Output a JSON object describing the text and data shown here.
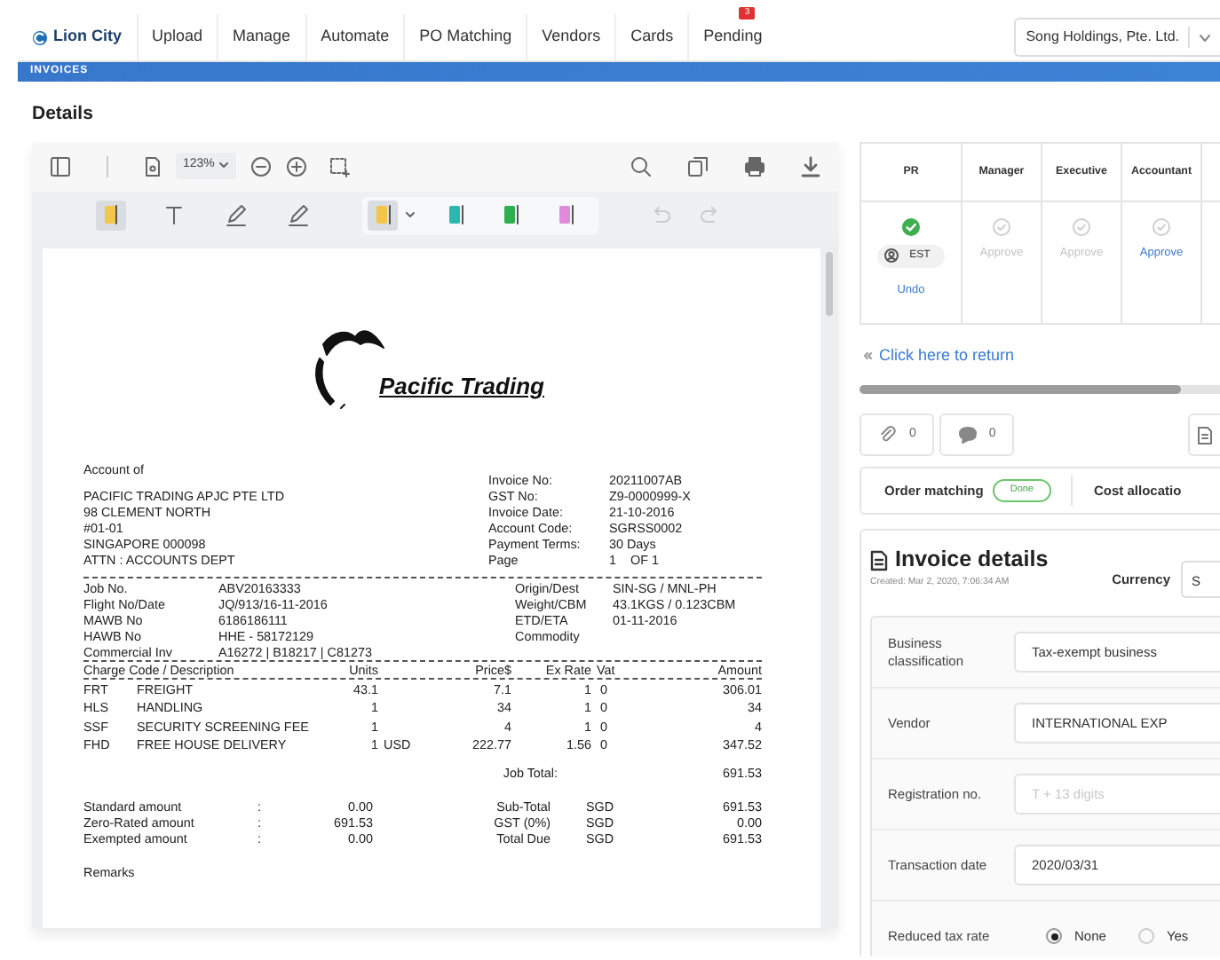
{
  "nav": {
    "logo": "Lion City",
    "tabs": [
      {
        "label": "Upload"
      },
      {
        "label": "Manage"
      },
      {
        "label": "Automate"
      },
      {
        "label": "PO Matching"
      },
      {
        "label": "Vendors"
      },
      {
        "label": "Cards"
      },
      {
        "label": "Pending",
        "badge": "3"
      }
    ],
    "company": "Song Holdings, Pte. Ltd."
  },
  "band": "INVOICES",
  "heading": "Details",
  "viewer": {
    "zoom": "123%",
    "tools": [
      {
        "kind": "highlight",
        "selected": true
      },
      {
        "kind": "text",
        "selected": false
      },
      {
        "kind": "pen",
        "selected": false
      },
      {
        "kind": "pen",
        "selected": false
      }
    ],
    "colors": [
      {
        "color": "#f3c54a",
        "selected": true
      },
      {
        "color": "#2bb8b0",
        "selected": false
      },
      {
        "color": "#2fae4e",
        "selected": false
      },
      {
        "color": "#e18bdc",
        "selected": false
      }
    ],
    "history": [
      {
        "kind": "undo",
        "disabled": true
      },
      {
        "kind": "redo",
        "disabled": true
      }
    ]
  },
  "document": {
    "company": "Pacific Trading",
    "account_title": "Account of",
    "address": [
      "PACIFIC TRADING APJC PTE LTD",
      "98 CLEMENT NORTH",
      "#01-01",
      "SINGAPORE 000098",
      "ATTN : ACCOUNTS DEPT"
    ],
    "invoice_info": [
      [
        "Invoice No:",
        "20211007AB"
      ],
      [
        "GST No:",
        "Z9-0000999-X"
      ],
      [
        "Invoice Date:",
        "21-10-2016"
      ],
      [
        "Account Code:",
        "SGRSS0002"
      ],
      [
        "Payment Terms:",
        "30 Days"
      ],
      [
        "Page",
        "1    OF 1"
      ]
    ],
    "shipment": [
      {
        "label": "Job No.",
        "value": "ABV20163333",
        "label_2": "Origin/Dest",
        "value_2": "SIN-SG / MNL-PH"
      },
      {
        "label": "Flight No/Date",
        "value": "JQ/913/16-11-2016",
        "label_2": "Weight/CBM",
        "value_2": "43.1KGS / 0.123CBM"
      },
      {
        "label": "MAWB No",
        "value": "6186186111",
        "label_2": "ETD/ETA",
        "value_2": "01-11-2016"
      },
      {
        "label": "HAWB No",
        "value": "HHE - 58172129",
        "label_2": "Commodity"
      },
      {
        "label": "Commercial Inv",
        "value": "A16272 | B18217 | C81273"
      }
    ],
    "charge_columns": [
      "Charge Code / Description",
      "Units",
      "Price$",
      "Ex Rate",
      "Vat",
      "Amount"
    ],
    "charges": [
      {
        "code": "FRT",
        "description": "FREIGHT",
        "units": "43.1",
        "price": "7.1",
        "ex_rate": "1",
        "vat": "0",
        "amount": "306.01"
      },
      {
        "code": "HLS",
        "description": "HANDLING",
        "units": "1",
        "price": "34",
        "ex_rate": "1",
        "vat": "0",
        "amount": "34"
      },
      {
        "code": "SSF",
        "description": "SECURITY SCREENING FEE",
        "units": "1",
        "price": "4",
        "ex_rate": "1",
        "vat": "0",
        "amount": "4"
      },
      {
        "code": "FHD",
        "description": "FREE HOUSE DELIVERY",
        "units": "1",
        "currency": "USD",
        "price": "222.77",
        "ex_rate": "1.56",
        "vat": "0",
        "amount": "347.52"
      }
    ],
    "job_total": [
      "Job Total:",
      "691.53"
    ],
    "summary": [
      [
        "Standard amount",
        ":",
        "0.00",
        "Sub-Total",
        "SGD",
        "691.53"
      ],
      [
        "Zero-Rated amount",
        ":",
        "691.53",
        "GST (0%)",
        "SGD",
        "0.00"
      ],
      [
        "Exempted amount",
        ":",
        "0.00",
        "Total Due",
        "SGD",
        "691.53"
      ]
    ],
    "remarks": "Remarks"
  },
  "approvals": [
    {
      "role": "PR",
      "approved": true,
      "user": "EST",
      "action": "Undo",
      "enabled": true
    },
    {
      "role": "Manager",
      "approved": false,
      "action": "Approve",
      "enabled": false
    },
    {
      "role": "Executive",
      "approved": false,
      "action": "Approve",
      "enabled": false
    },
    {
      "role": "Accountant",
      "approved": false,
      "action": "Approve",
      "enabled": true
    }
  ],
  "return_link": "Click here to return",
  "progress": {
    "level": 0.89
  },
  "counters": [
    {
      "kind": "attachment",
      "count": "0"
    },
    {
      "kind": "comment",
      "count": "0"
    }
  ],
  "order_matching": {
    "label": "Order matching",
    "status": "Done",
    "next": "Cost allocatio"
  },
  "invoice_details": {
    "title": "Invoice details",
    "created": "Created: Mar 2, 2020, 7:06:34 AM",
    "currency_label": "Currency",
    "currency_value": "S",
    "rows": [
      {
        "kind": "field",
        "label": "Business classification",
        "value": "Tax-exempt business"
      },
      {
        "kind": "field",
        "label": "Vendor",
        "value": "INTERNATIONAL EXP"
      },
      {
        "kind": "field",
        "label": "Registration no.",
        "placeholder": "T + 13 digits"
      },
      {
        "kind": "field",
        "label": "Transaction date",
        "value": "2020/03/31"
      },
      {
        "kind": "radio",
        "label": "Reduced tax rate",
        "options": [
          {
            "label": "None",
            "selected": true
          },
          {
            "label": "Yes",
            "selected": false
          }
        ]
      }
    ]
  }
}
